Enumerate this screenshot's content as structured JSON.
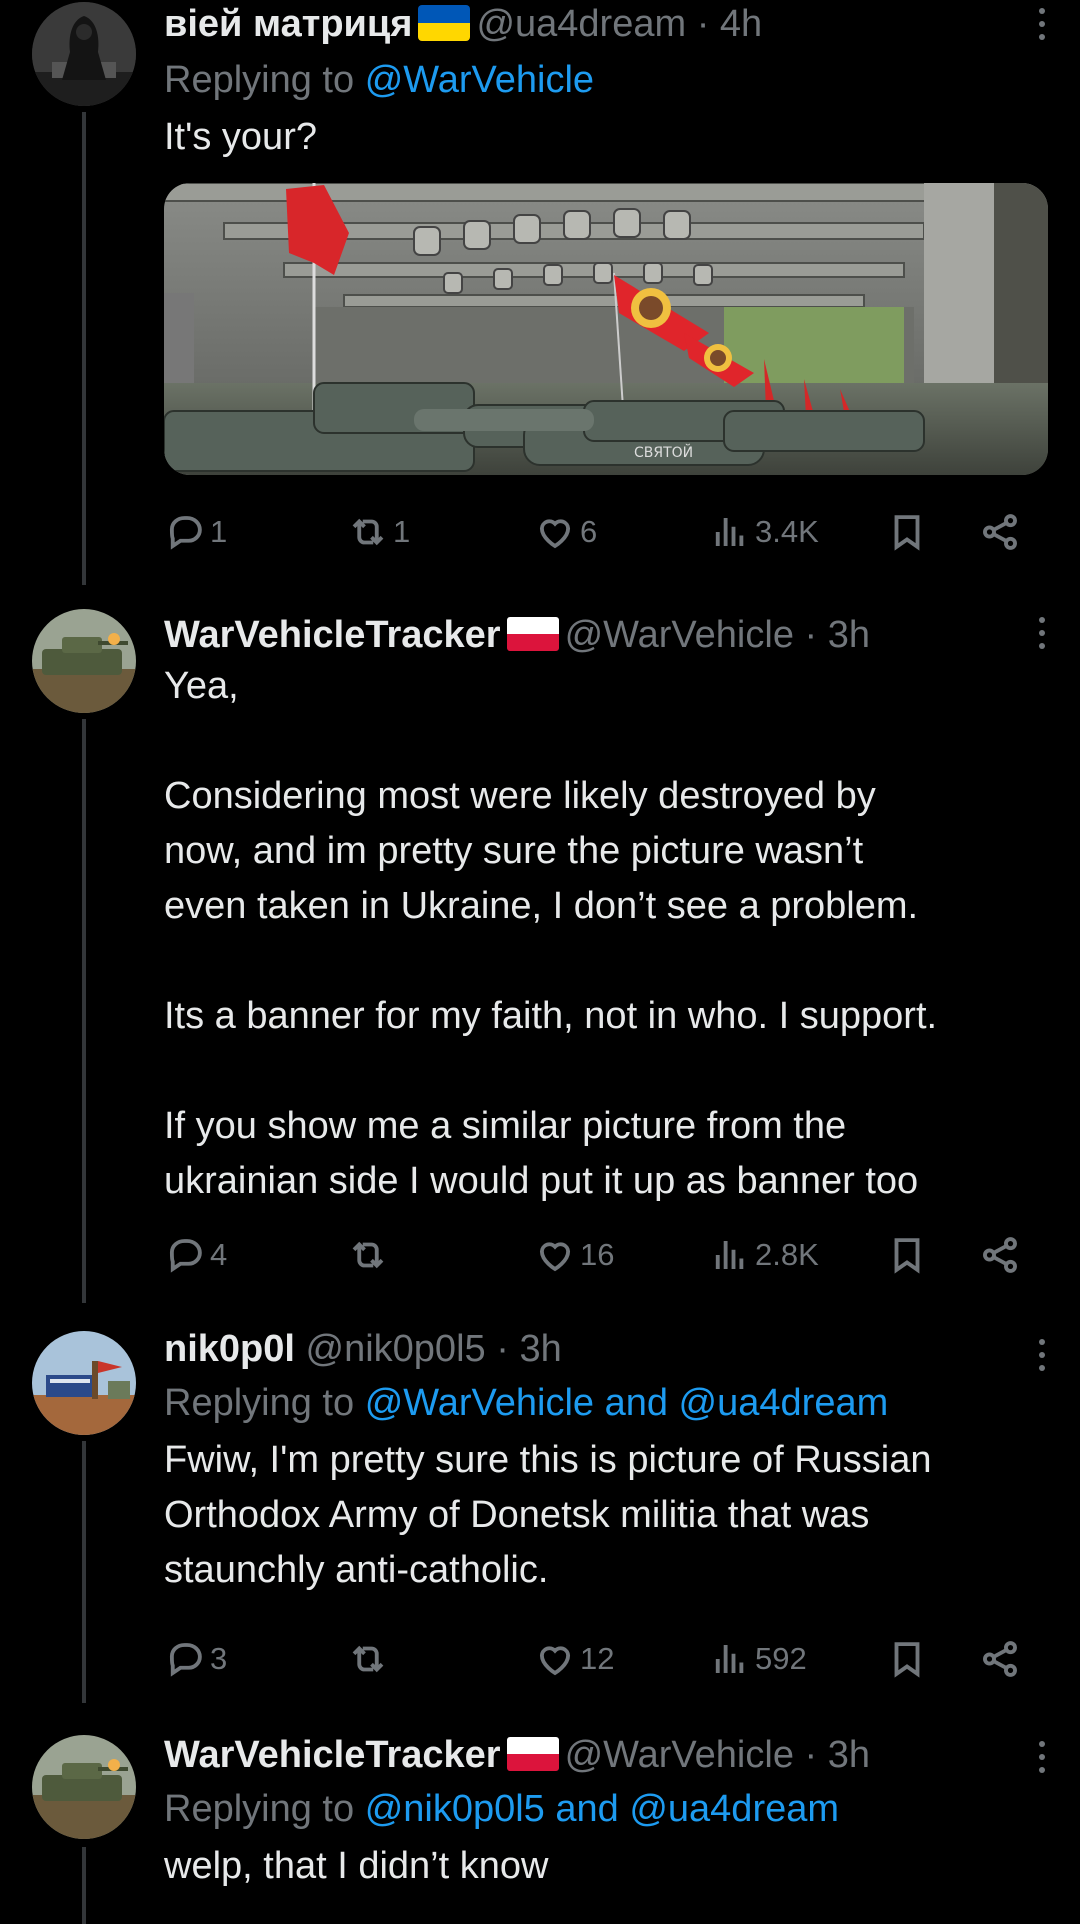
{
  "tweets": [
    {
      "display_name": "віей матриця",
      "handle": "@ua4dream",
      "time": "4h",
      "replying_prefix": "Replying to",
      "replying_to": "@WarVehicle",
      "text": "It's your?",
      "media": {
        "sign_text": "СВЯТОЙ"
      },
      "stats": {
        "replies": "1",
        "reposts": "1",
        "likes": "6",
        "views": "3.4K"
      }
    },
    {
      "display_name": "WarVehicleTracker",
      "handle": "@WarVehicle",
      "time": "3h",
      "text": "Yea,\n\nConsidering most were likely destroyed by\nnow, and im pretty sure the picture wasn’t\neven taken in Ukraine, I don’t see a problem.\n\nIts a banner for my faith, not in who. I support.\n\nIf you show me a similar picture from the\nukrainian side I would put it up as banner too",
      "stats": {
        "replies": "4",
        "reposts": "",
        "likes": "16",
        "views": "2.8K"
      }
    },
    {
      "display_name": "nik0p0l",
      "handle": "@nik0p0l5",
      "time": "3h",
      "replying_prefix": "Replying to",
      "replying_to": "@WarVehicle and @ua4dream",
      "text": "Fwiw, I'm pretty sure this is picture of Russian\nOrthodox Army of Donetsk militia that was\nstaunchly anti-catholic.",
      "stats": {
        "replies": "3",
        "reposts": "",
        "likes": "12",
        "views": "592"
      }
    },
    {
      "display_name": "WarVehicleTracker",
      "handle": "@WarVehicle",
      "time": "3h",
      "replying_prefix": "Replying to",
      "replying_to": "@nik0p0l5 and @ua4dream",
      "text": "welp, that I didn’t know"
    }
  ],
  "dot_separator": "·",
  "colors": {
    "background": "#000000",
    "text": "#e7e9ea",
    "muted": "#71767b",
    "link": "#1d9bf0"
  },
  "icons": [
    "reply-icon",
    "repost-icon",
    "like-icon",
    "views-icon",
    "bookmark-icon",
    "share-icon",
    "more-icon",
    "ukraine-flag",
    "poland-flag"
  ]
}
